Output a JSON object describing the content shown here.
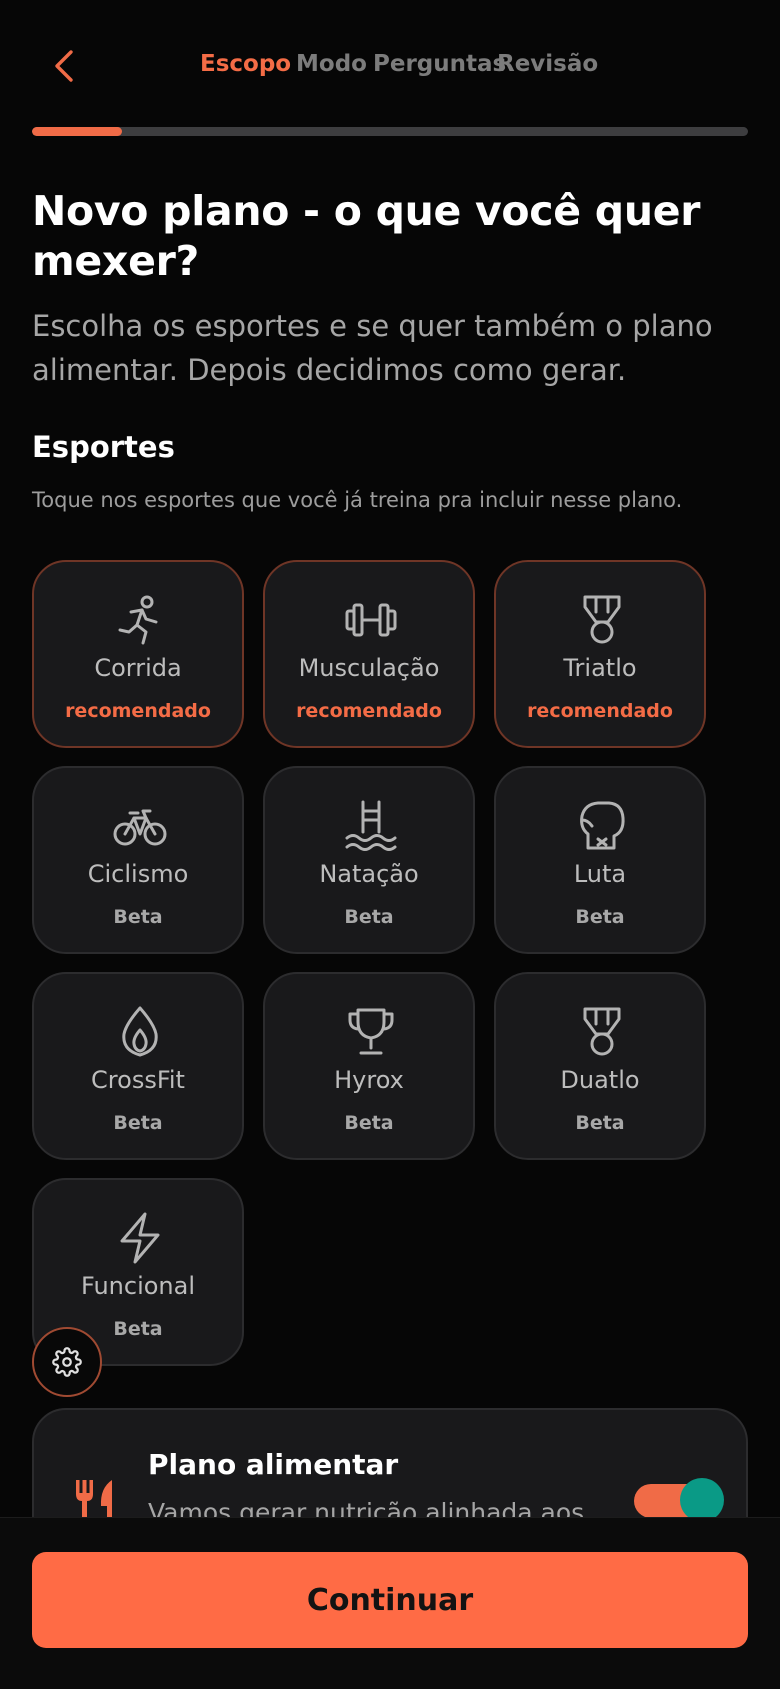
{
  "header": {
    "steps": [
      {
        "label": "Escopo",
        "active": true
      },
      {
        "label": "Modo",
        "active": false
      },
      {
        "label": "Perguntas",
        "active": false
      },
      {
        "label": "Revisão",
        "active": false
      }
    ],
    "progress": 0.125,
    "accent_color": "#f46c46"
  },
  "intro": {
    "title": "Novo plano - o que você quer mexer?",
    "subtitle": "Escolha os esportes e se quer também o plano alimentar. Depois decidimos como gerar."
  },
  "sports_section": {
    "title": "Esportes",
    "description": "Toque nos esportes que você já treina pra incluir nesse plano.",
    "items": [
      {
        "name": "Corrida",
        "badge": "recomendado",
        "icon": "running-icon",
        "recommended": true
      },
      {
        "name": "Musculação",
        "badge": "recomendado",
        "icon": "dumbbell-icon",
        "recommended": true
      },
      {
        "name": "Triatlo",
        "badge": "recomendado",
        "icon": "medal-icon",
        "recommended": true
      },
      {
        "name": "Ciclismo",
        "badge": "Beta",
        "icon": "bicycle-icon",
        "recommended": false
      },
      {
        "name": "Natação",
        "badge": "Beta",
        "icon": "pool-icon",
        "recommended": false
      },
      {
        "name": "Luta",
        "badge": "Beta",
        "icon": "boxing-glove-icon",
        "recommended": false
      },
      {
        "name": "CrossFit",
        "badge": "Beta",
        "icon": "flame-icon",
        "recommended": false
      },
      {
        "name": "Hyrox",
        "badge": "Beta",
        "icon": "trophy-icon",
        "recommended": false
      },
      {
        "name": "Duatlo",
        "badge": "Beta",
        "icon": "medal-icon",
        "recommended": false
      },
      {
        "name": "Funcional",
        "badge": "Beta",
        "icon": "lightning-icon",
        "recommended": false
      }
    ]
  },
  "meal_plan": {
    "title": "Plano alimentar",
    "description": "Vamos gerar nutrição alinhada aos",
    "icon": "fork-knife-icon",
    "enabled": true
  },
  "footer": {
    "continue_label": "Continuar"
  }
}
